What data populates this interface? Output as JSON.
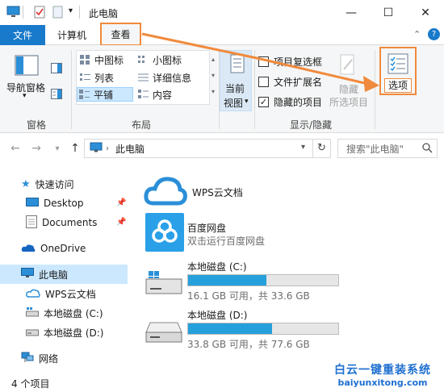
{
  "window": {
    "title": "此电脑",
    "minimize": "—",
    "maximize": "☐",
    "close": "✕"
  },
  "tabs": [
    {
      "label": "文件"
    },
    {
      "label": "计算机"
    },
    {
      "label": "查看"
    }
  ],
  "ribbon": {
    "panes": {
      "nav_pane": "导航窗格",
      "group": "窗格"
    },
    "layout": {
      "items": [
        "中图标",
        "小图标",
        "列表",
        "详细信息",
        "平铺",
        "内容"
      ],
      "group": "布局"
    },
    "current_view": {
      "line1": "当前",
      "line2": "视图"
    },
    "show_hide": {
      "item_checkboxes": "项目复选框",
      "file_extensions": "文件扩展名",
      "hidden_items": "隐藏的项目",
      "hide_line1": "隐藏",
      "hide_line2": "所选项目",
      "group": "显示/隐藏"
    },
    "options": "选项"
  },
  "address": {
    "path": "此电脑",
    "search_placeholder": "搜索\"此电脑\""
  },
  "nav": {
    "quick_access": "快速访问",
    "desktop": "Desktop",
    "documents": "Documents",
    "onedrive": "OneDrive",
    "this_pc": "此电脑",
    "wps": "WPS云文档",
    "disk_c": "本地磁盘 (C:)",
    "disk_d": "本地磁盘 (D:)",
    "network": "网络"
  },
  "content": {
    "wps": {
      "name": "WPS云文档"
    },
    "baidu": {
      "name": "百度网盘",
      "desc": "双击运行百度网盘"
    },
    "disk_c": {
      "name": "本地磁盘 (C:)",
      "free": "16.1 GB 可用，共 33.6 GB",
      "used_fraction": 0.52
    },
    "disk_d": {
      "name": "本地磁盘 (D:)",
      "free": "33.8 GB 可用，共 77.6 GB",
      "used_fraction": 0.56
    }
  },
  "status": {
    "count": "4 个项目"
  },
  "watermark": {
    "line1": "白云一键重装系统",
    "line2": "baiyunxitong.com"
  },
  "colors": {
    "accent": "#1979ca",
    "highlight": "#f08a3c",
    "drive_fill": "#26a0da"
  }
}
